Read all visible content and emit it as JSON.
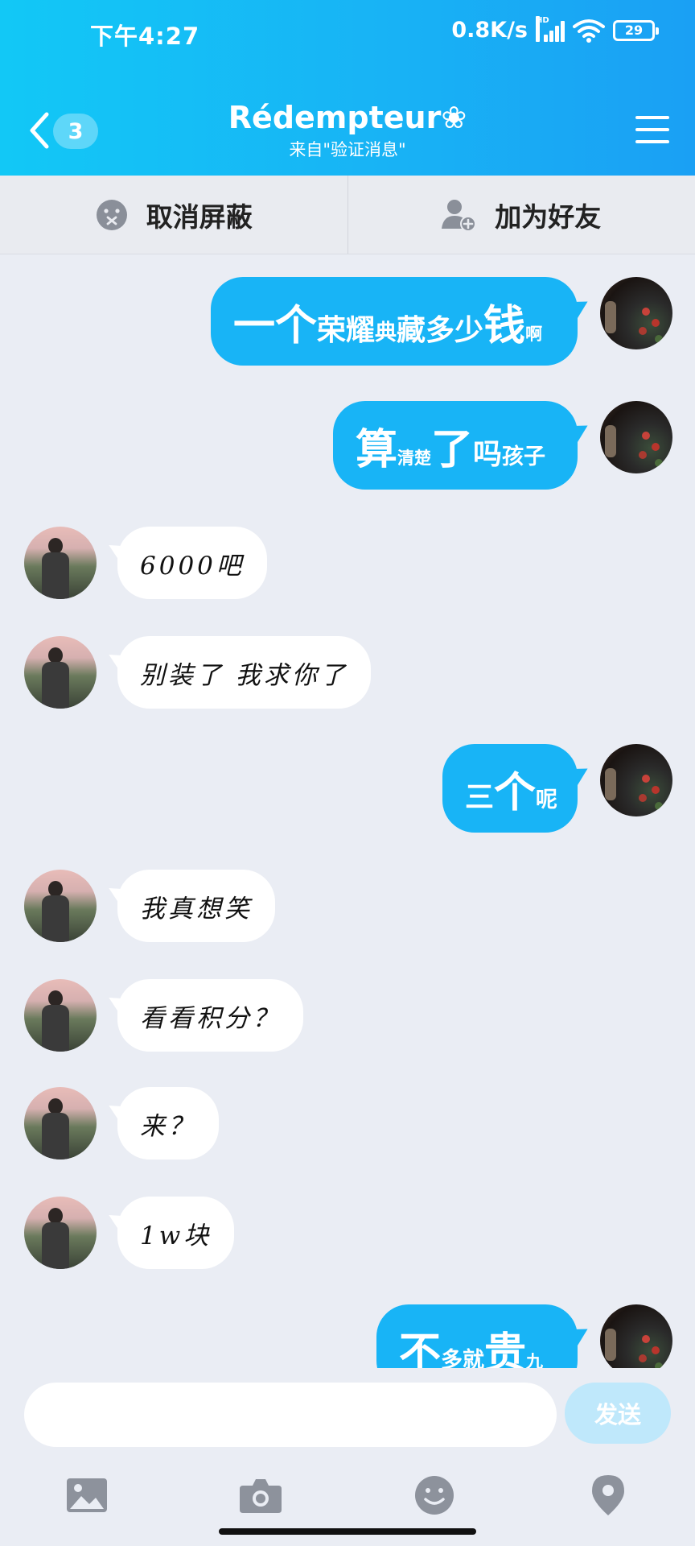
{
  "status_bar": {
    "time": "下午4:27",
    "network_speed": "0.8K/s",
    "network_badge": "HD",
    "battery": "29"
  },
  "nav": {
    "unread_count": "3",
    "title": "Rédempteur",
    "title_symbol": "❀",
    "subtitle": "来自\"验证消息\""
  },
  "actions": {
    "unblock_label": "取消屏蔽",
    "add_friend_label": "加为好友"
  },
  "messages": [
    {
      "from": "me",
      "segments": [
        [
          "一个",
          "big"
        ],
        [
          "荣耀",
          "md"
        ],
        [
          "典",
          "sm"
        ],
        [
          "藏多少",
          "md"
        ],
        [
          "钱",
          "big"
        ],
        [
          "啊",
          "xs"
        ]
      ]
    },
    {
      "from": "me",
      "segments": [
        [
          "算",
          "big"
        ],
        [
          "清楚",
          "xs"
        ],
        [
          "了",
          "big"
        ],
        [
          "吗",
          "md"
        ],
        [
          "孩子",
          "sm"
        ]
      ]
    },
    {
      "from": "them",
      "text": "6000吧"
    },
    {
      "from": "them",
      "text": "别装了 我求你了"
    },
    {
      "from": "me",
      "segments": [
        [
          "三",
          "md"
        ],
        [
          "个",
          "big"
        ],
        [
          "呢",
          "sm"
        ]
      ]
    },
    {
      "from": "them",
      "text": "我真想笑"
    },
    {
      "from": "them",
      "text": "看看积分？"
    },
    {
      "from": "them",
      "text": "来？"
    },
    {
      "from": "them",
      "text": "1w块"
    },
    {
      "from": "me",
      "segments": [
        [
          "不",
          "big"
        ],
        [
          "多就",
          "sm"
        ],
        [
          "贵",
          "big"
        ],
        [
          "九",
          "xs"
        ]
      ]
    }
  ],
  "input": {
    "value": "",
    "placeholder": "",
    "send_label": "发送"
  },
  "toolbar_icons": [
    "image-icon",
    "camera-icon",
    "emoji-icon",
    "location-icon"
  ],
  "colors": {
    "header_start": "#12c8f6",
    "header_end": "#1aa0f4",
    "outgoing_bubble": "#18b4f6",
    "incoming_bubble": "#ffffff",
    "background": "#eaedf4",
    "send_disabled": "#bfe8fb"
  }
}
